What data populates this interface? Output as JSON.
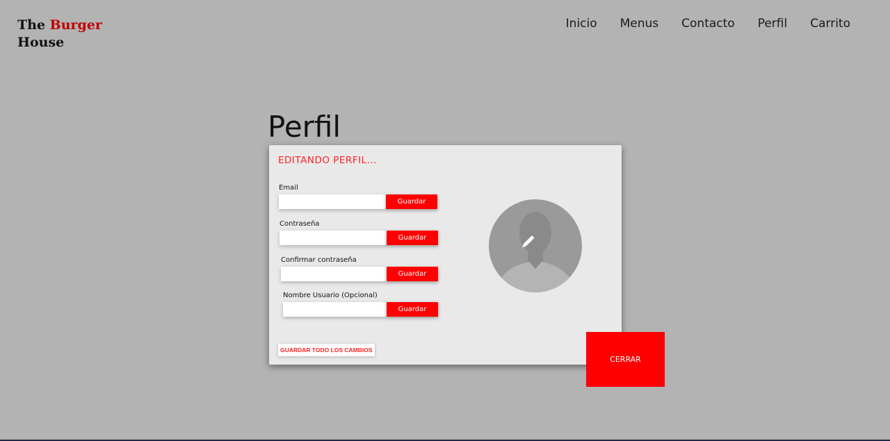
{
  "header": {
    "logo": {
      "word1": "The",
      "word2": "Burger",
      "word3": "House"
    },
    "nav": [
      "Inicio",
      "Menus",
      "Contacto",
      "Perfil",
      "Carrito"
    ]
  },
  "page_title": "Perfil",
  "modal": {
    "heading": "EDITANDO PERFIL...",
    "fields": [
      {
        "label": "Email",
        "value": "",
        "button": "Guardar"
      },
      {
        "label": "Contraseña",
        "value": "",
        "button": "Guardar"
      },
      {
        "label": "Confirmar contraseña",
        "value": "",
        "button": "Guardar"
      },
      {
        "label": "Nombre Usuario (Opcional)",
        "value": "",
        "button": "Guardar"
      }
    ],
    "save_all": "GUARDAR TODO LOS CAMBIOS",
    "avatar_icon": "user-silhouette-icon",
    "edit_icon": "pencil-icon"
  },
  "close_button": "CERRAR",
  "colors": {
    "background": "#b3b3b3",
    "accent": "#ff0000",
    "logo_accent": "#c00000",
    "modal_bg": "#e9e9e9"
  }
}
